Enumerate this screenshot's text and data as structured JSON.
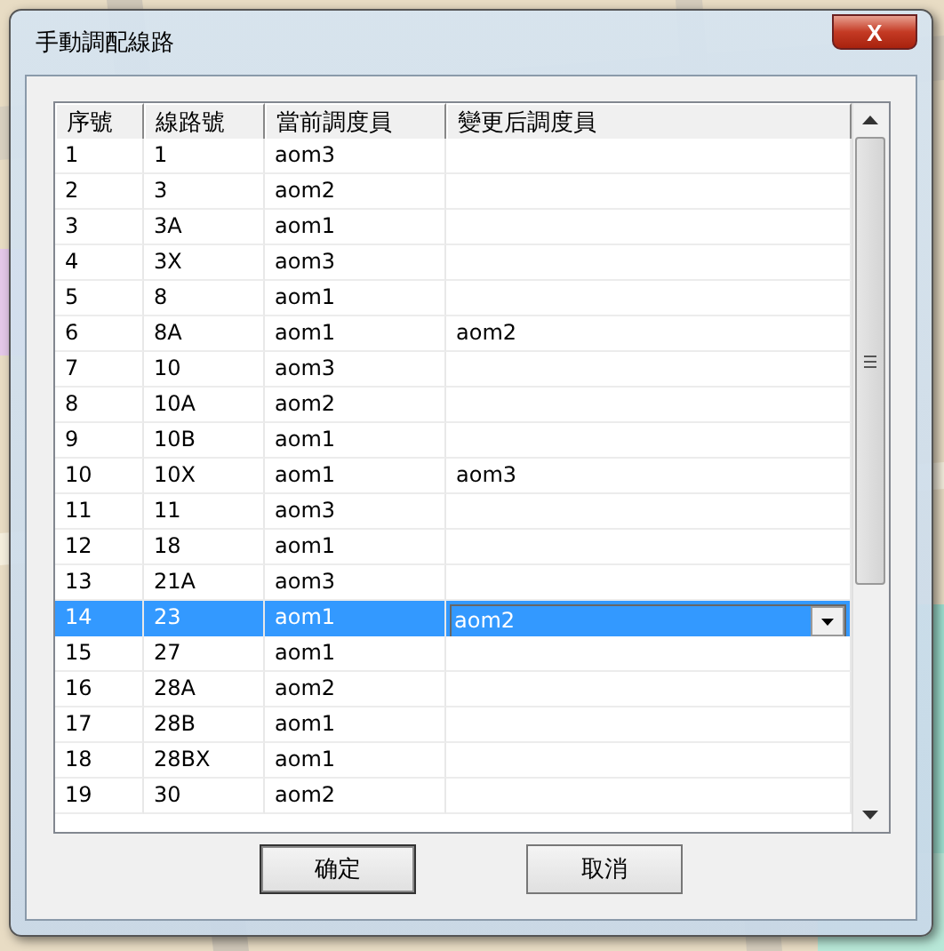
{
  "window": {
    "title": "手動調配線路",
    "close": "X"
  },
  "table": {
    "columns": [
      "序號",
      "線路號",
      "當前調度員",
      "變更后調度員"
    ],
    "rows": [
      {
        "cells": [
          "1",
          "1",
          "aom3",
          ""
        ],
        "selected": false
      },
      {
        "cells": [
          "2",
          "3",
          "aom2",
          ""
        ],
        "selected": false
      },
      {
        "cells": [
          "3",
          "3A",
          "aom1",
          ""
        ],
        "selected": false
      },
      {
        "cells": [
          "4",
          "3X",
          "aom3",
          ""
        ],
        "selected": false
      },
      {
        "cells": [
          "5",
          "8",
          "aom1",
          ""
        ],
        "selected": false
      },
      {
        "cells": [
          "6",
          "8A",
          "aom1",
          "aom2"
        ],
        "selected": false
      },
      {
        "cells": [
          "7",
          "10",
          "aom3",
          ""
        ],
        "selected": false
      },
      {
        "cells": [
          "8",
          "10A",
          "aom2",
          ""
        ],
        "selected": false
      },
      {
        "cells": [
          "9",
          "10B",
          "aom1",
          ""
        ],
        "selected": false
      },
      {
        "cells": [
          "10",
          "10X",
          "aom1",
          "aom3"
        ],
        "selected": false
      },
      {
        "cells": [
          "11",
          "11",
          "aom3",
          ""
        ],
        "selected": false
      },
      {
        "cells": [
          "12",
          "18",
          "aom1",
          ""
        ],
        "selected": false
      },
      {
        "cells": [
          "13",
          "21A",
          "aom3",
          ""
        ],
        "selected": false
      },
      {
        "cells": [
          "14",
          "23",
          "aom1",
          "aom2"
        ],
        "selected": true,
        "editing": true
      },
      {
        "cells": [
          "15",
          "27",
          "aom1",
          ""
        ],
        "selected": false
      },
      {
        "cells": [
          "16",
          "28A",
          "aom2",
          ""
        ],
        "selected": false
      },
      {
        "cells": [
          "17",
          "28B",
          "aom1",
          ""
        ],
        "selected": false
      },
      {
        "cells": [
          "18",
          "28BX",
          "aom1",
          ""
        ],
        "selected": false
      },
      {
        "cells": [
          "19",
          "30",
          "aom2",
          ""
        ],
        "selected": false
      }
    ]
  },
  "buttons": [
    "确定",
    "取消"
  ]
}
